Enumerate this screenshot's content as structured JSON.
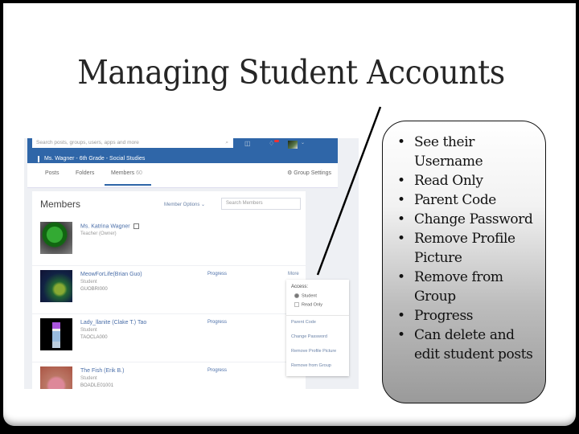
{
  "slide": {
    "title": "Managing Student Accounts"
  },
  "app": {
    "search_placeholder": "Search posts, groups, users, apps and more",
    "search_icon": "magnifier-icon",
    "header_icons": [
      "apps-icon",
      "notifications-icon",
      "profile-avatar"
    ],
    "group_name": "Ms. Wagner - 6th Grade - Social Studies",
    "tabs": [
      {
        "label": "Posts"
      },
      {
        "label": "Folders"
      },
      {
        "label": "Members",
        "count": "60",
        "active": true
      }
    ],
    "group_settings_label": "Group Settings",
    "members_heading": "Members",
    "member_options_label": "Member Options",
    "member_search_placeholder": "Search Members",
    "members": [
      {
        "name": "Ms. Katrina Wagner",
        "role": "Teacher (Owner)",
        "code": "",
        "progress": "",
        "more": ""
      },
      {
        "name": "MeowForLife(Brian Guo)",
        "role": "Student",
        "code": "GUOBRI000",
        "progress": "Progress",
        "more": "More"
      },
      {
        "name": "Lady_llanite (Clake T.) Tao",
        "role": "Student",
        "code": "TAOCLA000",
        "progress": "Progress",
        "more": ""
      },
      {
        "name": "The Fish (Erik B.)",
        "role": "Student",
        "code": "BOADLE01001",
        "progress": "Progress",
        "more": ""
      }
    ],
    "more_menu": {
      "access_label": "Access:",
      "options": [
        {
          "label": "Student",
          "selected": true
        },
        {
          "label": "Read Only",
          "selected": false
        }
      ],
      "items": [
        "Parent Code",
        "Change Password",
        "Remove Profile Picture",
        "Remove from Group"
      ]
    }
  },
  "callout": {
    "items": [
      "See their Username",
      "Read Only",
      "Parent Code",
      "Change Password",
      "Remove Profile Picture",
      "Remove from Group",
      "Progress",
      "Can delete and edit student posts"
    ]
  }
}
